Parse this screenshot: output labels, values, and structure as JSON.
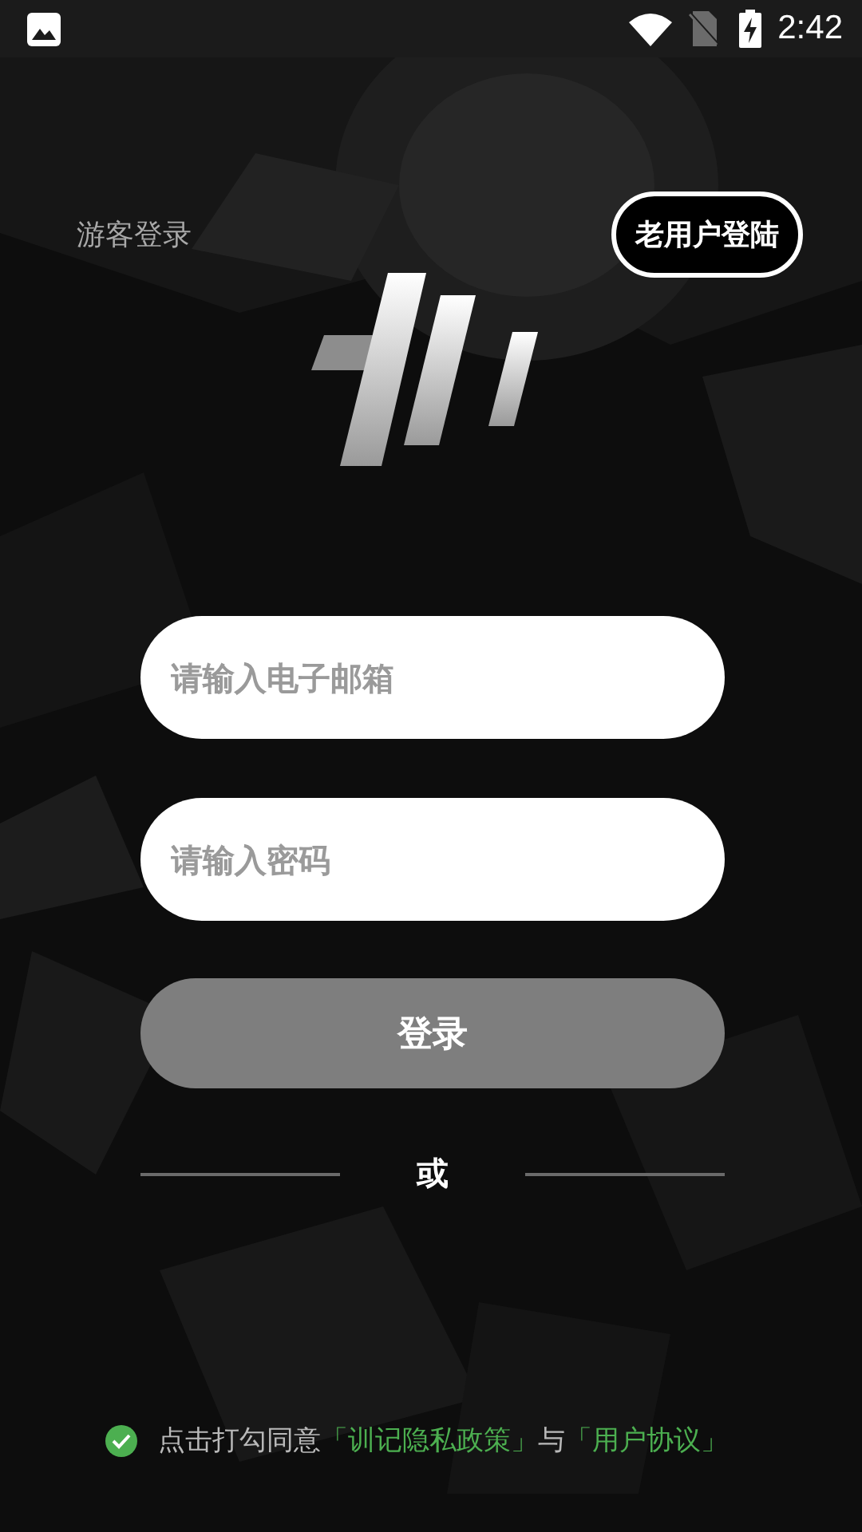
{
  "status_bar": {
    "time": "2:42"
  },
  "guest_login": {
    "label": "游客登录"
  },
  "old_user_button": {
    "label": "老用户登陆"
  },
  "email_field": {
    "placeholder": "请输入电子邮箱"
  },
  "password_field": {
    "placeholder": "请输入密码"
  },
  "login_button": {
    "label": "登录",
    "disabled": true
  },
  "divider": {
    "label": "或"
  },
  "agreement": {
    "checked": true,
    "parts": [
      {
        "kind": "text",
        "text": "点击打勾同意"
      },
      {
        "kind": "link",
        "text": "「训记隐私政策」"
      },
      {
        "kind": "text",
        "text": "与"
      },
      {
        "kind": "link",
        "text": "「用户协议」"
      }
    ]
  }
}
